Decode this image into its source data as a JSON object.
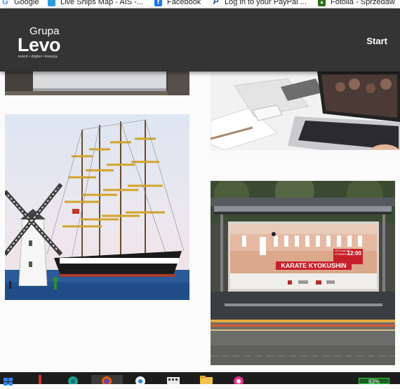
{
  "bookmarks": [
    {
      "label": "Google",
      "icon": "google-icon"
    },
    {
      "label": "Live Ships Map - AIS -...",
      "icon": "ship-icon"
    },
    {
      "label": "Facebook",
      "icon": "facebook-icon"
    },
    {
      "label": "Log in to your PayPal ...",
      "icon": "paypal-icon"
    },
    {
      "label": "Fotolia - Sprzedaw",
      "icon": "fotolia-icon"
    }
  ],
  "header": {
    "logo": {
      "line1": "Grupa",
      "line2": "Levo",
      "tagline": "event • digital • kreacja"
    },
    "nav": {
      "start": "Start"
    }
  },
  "poster": {
    "badge_line1": "OFICJALNE",
    "badge_line2": "OTWARCIE",
    "time": "12:00",
    "title": "KARATE KYOKUSHIN"
  },
  "taskbar": {
    "icons": [
      "windows-icon",
      "paint-icon",
      "edge-icon",
      "firefox-icon",
      "chrome-icon",
      "media-icon",
      "folder-icon",
      "creative-cloud-icon"
    ],
    "battery": "83%"
  },
  "colors": {
    "header_bg": "#343434",
    "page_bg": "#fbfbfb",
    "poster_red": "#c8202a"
  }
}
